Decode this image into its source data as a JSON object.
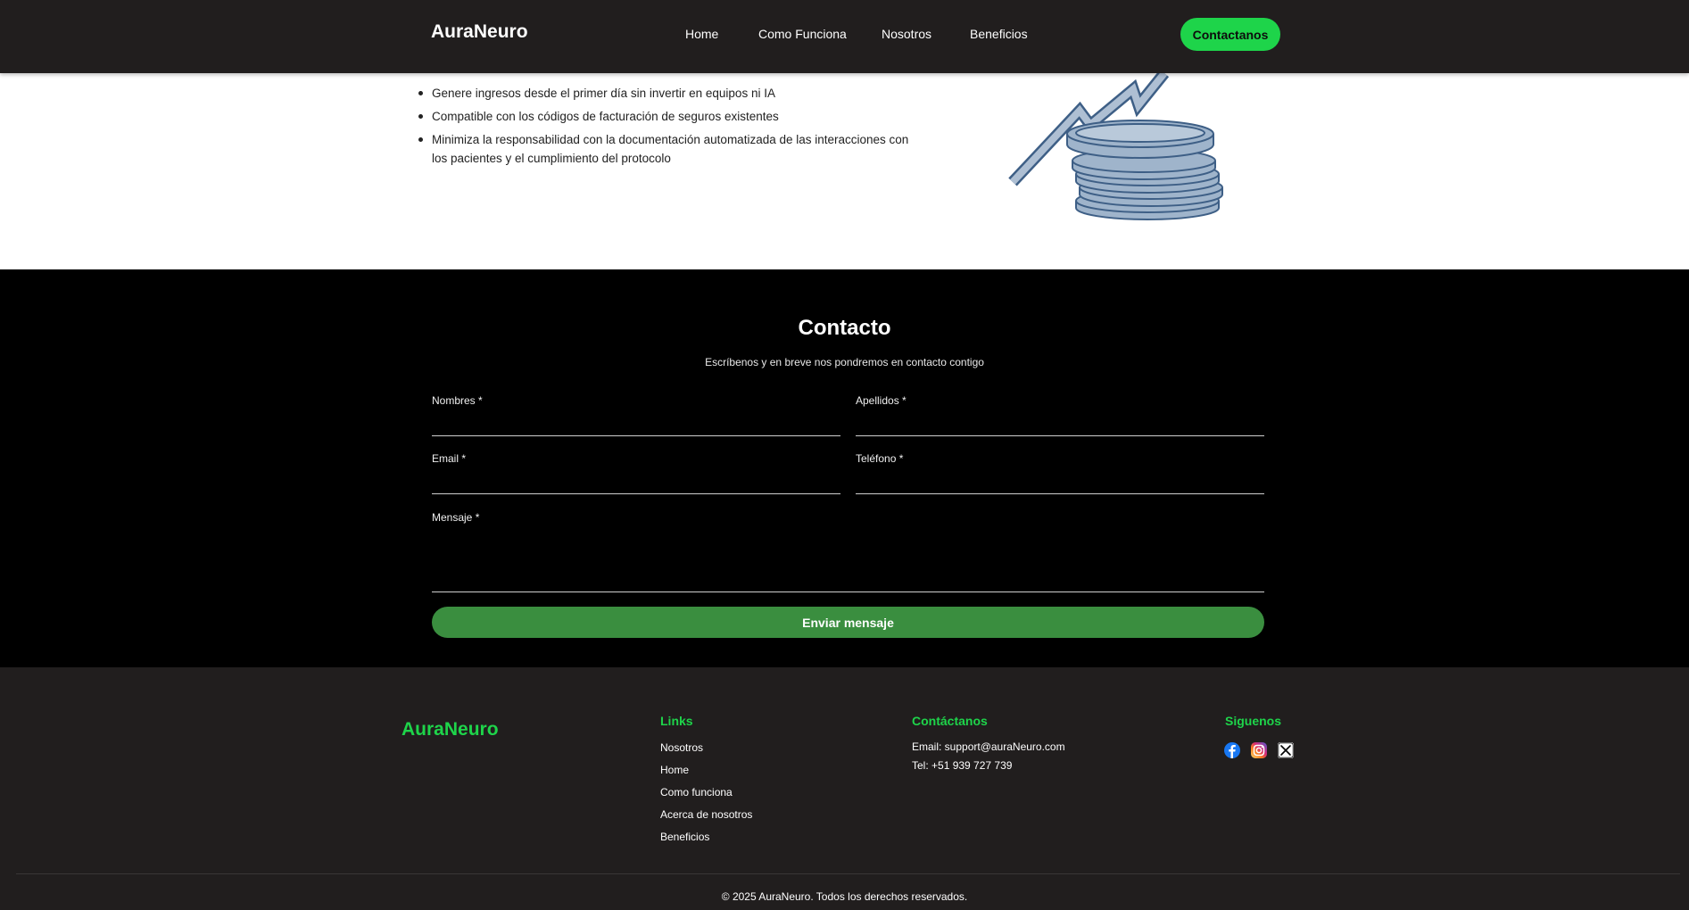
{
  "navbar": {
    "brand": "AuraNeuro",
    "links": [
      {
        "label": "Home"
      },
      {
        "label": "Como Funciona"
      },
      {
        "label": "Nosotros"
      },
      {
        "label": "Beneficios"
      }
    ],
    "cta_label": "Contactanos"
  },
  "benefits": {
    "items": [
      "Genere ingresos desde el primer día sin invertir en equipos ni IA",
      "Compatible con los códigos de facturación de seguros existentes",
      "Minimiza la responsabilidad con la documentación automatizada de las interacciones con los pacientes y el cumplimiento del protocolo"
    ],
    "illustration_icon": "coins-growth-icon"
  },
  "contact": {
    "title": "Contacto",
    "subtitle": "Escríbenos y en breve nos pondremos en contacto contigo",
    "fields": {
      "nombres": {
        "label": "Nombres *",
        "value": ""
      },
      "apellidos": {
        "label": "Apellidos *",
        "value": ""
      },
      "email": {
        "label": "Email *",
        "value": ""
      },
      "telefono": {
        "label": "Teléfono *",
        "value": ""
      },
      "mensaje": {
        "label": "Mensaje *",
        "value": ""
      }
    },
    "submit_label": "Enviar mensaje"
  },
  "footer": {
    "brand": "AuraNeuro",
    "links_heading": "Links",
    "links": [
      "Nosotros",
      "Home",
      "Como funciona",
      "Acerca de nosotros",
      "Beneficios"
    ],
    "contact_heading": "Contáctanos",
    "email": "Email: support@auraNeuro.com",
    "phone": "Tel: +51 939 727 739",
    "social_heading": "Siguenos",
    "social": [
      {
        "icon": "facebook-icon",
        "color": "#1877f2"
      },
      {
        "icon": "instagram-icon",
        "color": "#e1306c"
      },
      {
        "icon": "x-icon",
        "color": "#000000"
      }
    ],
    "copyright": "© 2025 AuraNeuro. Todos los derechos reservados."
  },
  "colors": {
    "nav_bg": "#211e1e",
    "accent_green": "#1ed44a",
    "submit_green": "#3a8e3f",
    "contact_bg": "#000000"
  }
}
